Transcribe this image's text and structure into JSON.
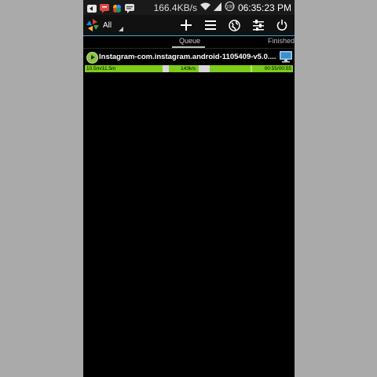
{
  "status_bar": {
    "speed": "166.4KB/s",
    "time": "06:35:23 PM",
    "notification_icons": [
      "back-arrow-icon",
      "chat-icon",
      "flower-icon",
      "message-icon"
    ],
    "system_icons": [
      "wifi-icon",
      "signal-icon",
      "battery-icon"
    ]
  },
  "toolbar": {
    "filter_label": "All",
    "buttons": [
      "add-icon",
      "menu-list-icon",
      "globe-icon",
      "settings-sliders-icon",
      "power-icon"
    ]
  },
  "tabs": [
    {
      "label": "Queue",
      "active": true
    },
    {
      "label": "Finished",
      "active": false
    }
  ],
  "download": {
    "name": "Instagram-com.instagram.android-1105409-v5.0....",
    "size": "10.5m/11.5m",
    "speed": "143k/s",
    "time": "00:55/00:55",
    "progress": 0.91
  },
  "colors": {
    "accent_line": "#3aa7d8",
    "progress_green": "#7ccd1a",
    "background": "#000000"
  }
}
